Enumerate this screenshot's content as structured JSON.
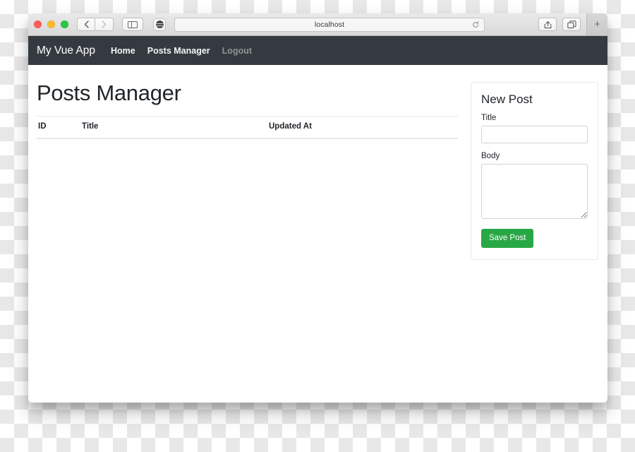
{
  "browser": {
    "window_controls": {
      "close_label": "close",
      "minimize_label": "minimize",
      "maximize_label": "maximize"
    },
    "back_glyph": "‹",
    "forward_glyph": "›",
    "sidebar_icon": "sidebar-icon",
    "blocker_icon": "content-blocker-icon",
    "address": {
      "url": "localhost",
      "reload_icon": "reload-icon"
    },
    "share_icon": "share-icon",
    "tabs_icon": "show-tabs-icon",
    "new_tab_glyph": "+"
  },
  "navbar": {
    "brand": "My Vue App",
    "links": [
      {
        "label": "Home",
        "muted": false
      },
      {
        "label": "Posts Manager",
        "muted": false
      },
      {
        "label": "Logout",
        "muted": true
      }
    ]
  },
  "main": {
    "title": "Posts Manager",
    "table": {
      "columns": [
        "ID",
        "Title",
        "Updated At"
      ],
      "rows": []
    }
  },
  "new_post": {
    "heading": "New Post",
    "title_label": "Title",
    "title_value": "",
    "title_placeholder": "",
    "body_label": "Body",
    "body_value": "",
    "body_placeholder": "",
    "save_label": "Save Post"
  },
  "colors": {
    "navbar_bg": "#343a40",
    "save_button": "#28a745",
    "card_border": "#e7e8ea",
    "text": "#212529"
  }
}
